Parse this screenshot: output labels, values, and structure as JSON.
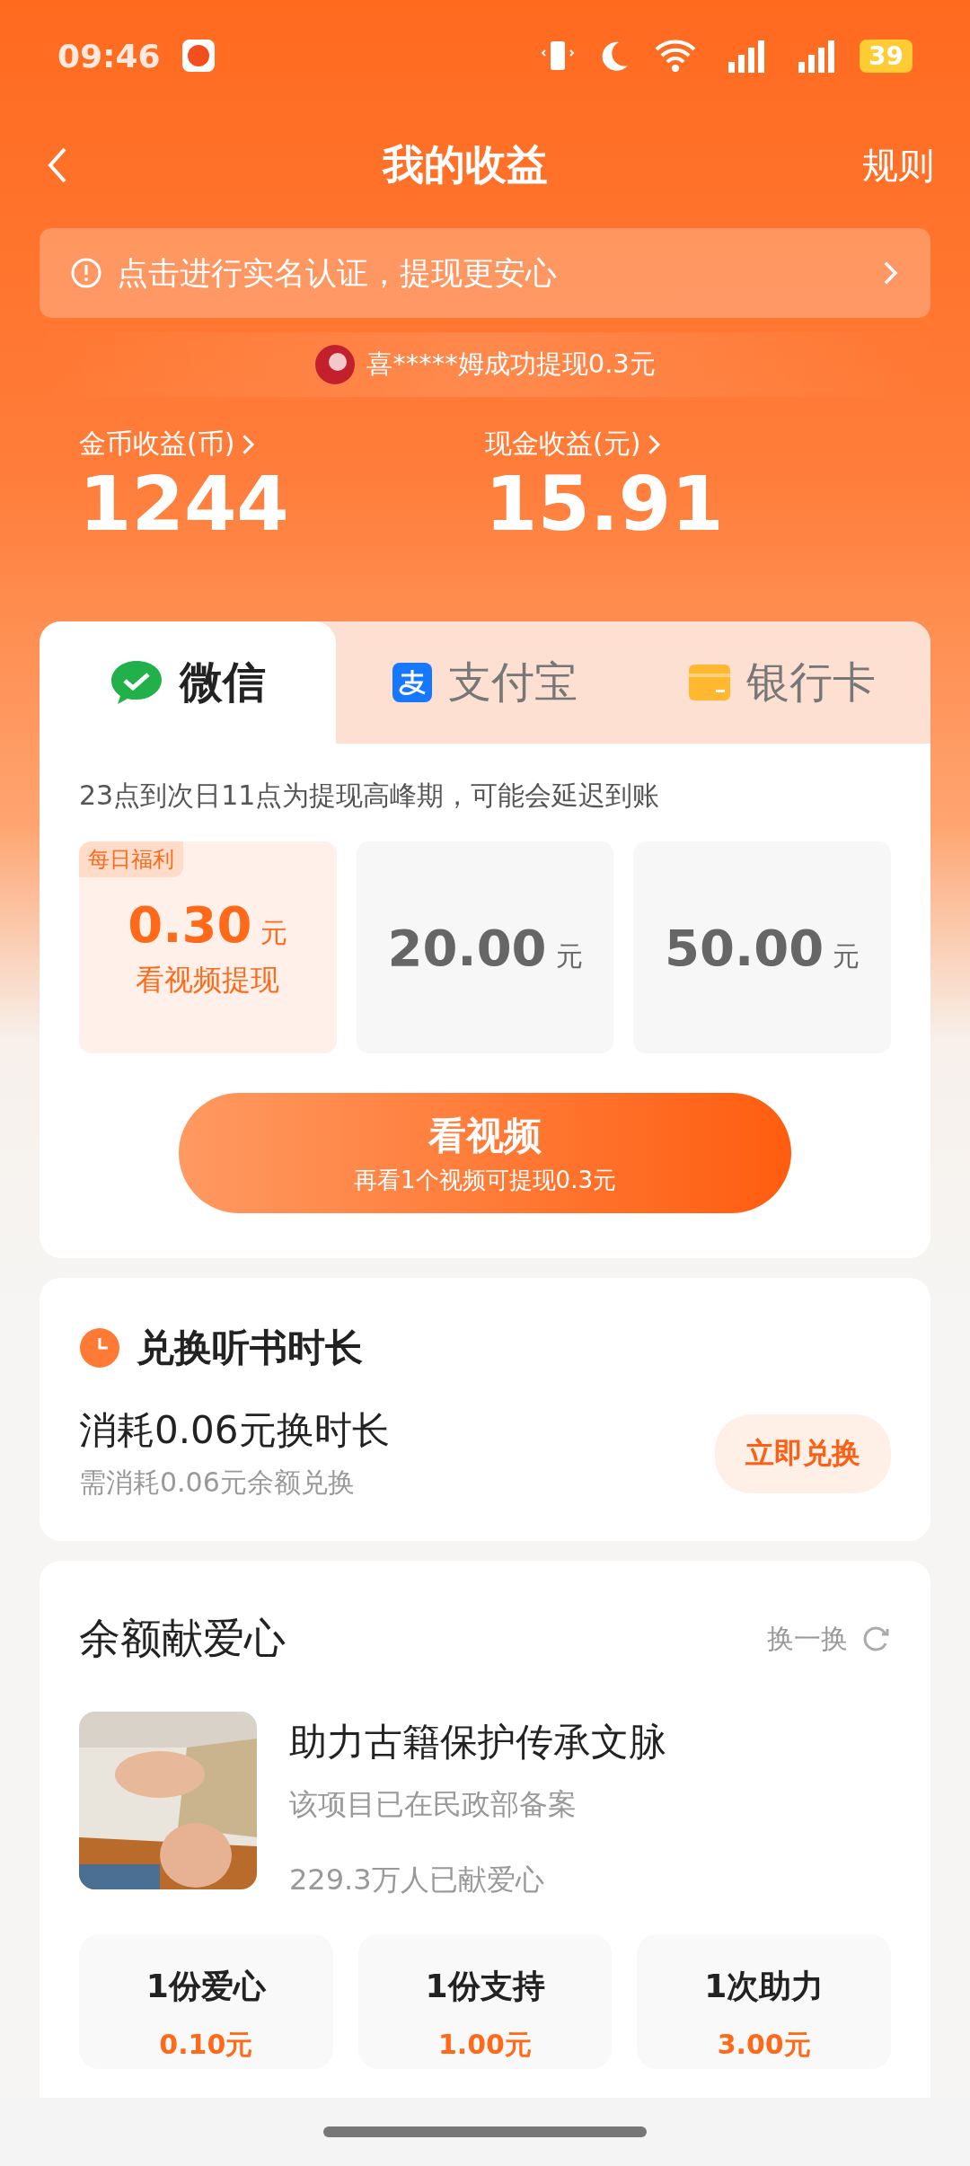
{
  "status_bar": {
    "time": "09:46",
    "battery": "39"
  },
  "nav": {
    "title": "我的收益",
    "action": "规则"
  },
  "notice": {
    "text": "点击进行实名认证，提现更安心"
  },
  "ticker": {
    "text": "喜*****姆成功提现0.3元"
  },
  "balances": [
    {
      "label": "金币收益(币)",
      "value": "1244"
    },
    {
      "label": "现金收益(元)",
      "value": "15.91"
    }
  ],
  "tabs": [
    {
      "kind": "wechat",
      "label": "微信",
      "selected": true
    },
    {
      "kind": "alipay",
      "label": "支付宝",
      "selected": false
    },
    {
      "kind": "bank",
      "label": "银行卡",
      "selected": false
    }
  ],
  "note": "23点到次日11点为提现高峰期，可能会延迟到账",
  "amounts": [
    {
      "badge": "每日福利",
      "value": "0.30",
      "unit": "元",
      "caption": "看视频提现",
      "selected": true
    },
    {
      "value": "20.00",
      "unit": "元",
      "selected": false
    },
    {
      "value": "50.00",
      "unit": "元",
      "selected": false
    }
  ],
  "watch_button": {
    "label": "看视频",
    "sublabel": "再看1个视频可提现0.3元"
  },
  "exchange": {
    "title": "兑换听书时长",
    "main": "消耗0.06元换时长",
    "sub": "需消耗0.06元余额兑换",
    "button": "立即兑换"
  },
  "charity": {
    "title": "余额献爱心",
    "refresh": "换一换",
    "project": {
      "title": "助力古籍保护传承文脉",
      "subtitle": "该项目已在民政部备案",
      "count": "229.3万人已献爱心"
    },
    "options": [
      {
        "label": "1份爱心",
        "price": "0.10元"
      },
      {
        "label": "1份支持",
        "price": "1.00元"
      },
      {
        "label": "1次助力",
        "price": "3.00元"
      }
    ]
  }
}
